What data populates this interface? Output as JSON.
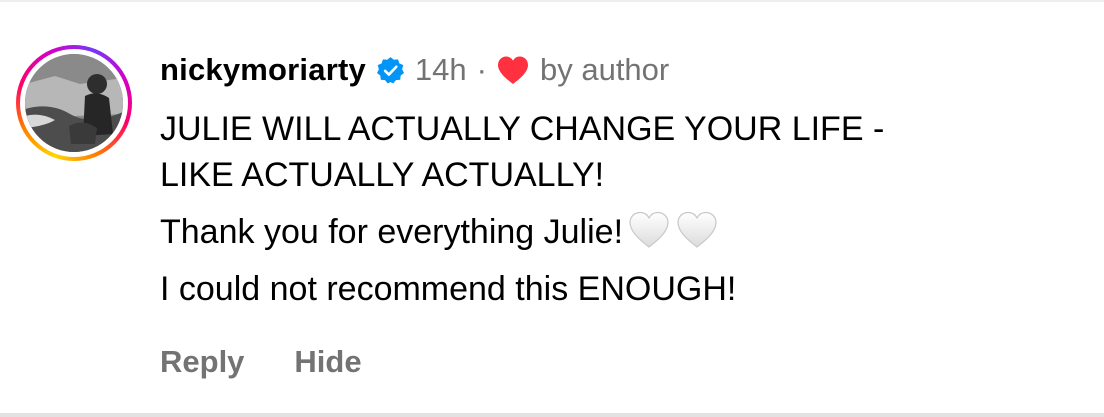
{
  "comment": {
    "username": "nickymoriarty",
    "time": "14h",
    "separator": "·",
    "liked_by": "by author",
    "lines": [
      "JULIE WILL ACTUALLY CHANGE YOUR LIFE -",
      "LIKE ACTUALLY ACTUALLY!",
      "Thank you for everything Julie!",
      "I could not recommend this ENOUGH!"
    ],
    "line3_emoji": [
      "white-heart-icon",
      "white-heart-icon"
    ],
    "actions": {
      "reply": "Reply",
      "hide": "Hide"
    }
  },
  "icons": {
    "verified": "verified-badge-icon",
    "liked": "red-heart-icon"
  },
  "colors": {
    "verified_blue": "#0095f6",
    "heart_red": "#ff3040",
    "secondary_text": "#737373",
    "primary_text": "#000000"
  }
}
